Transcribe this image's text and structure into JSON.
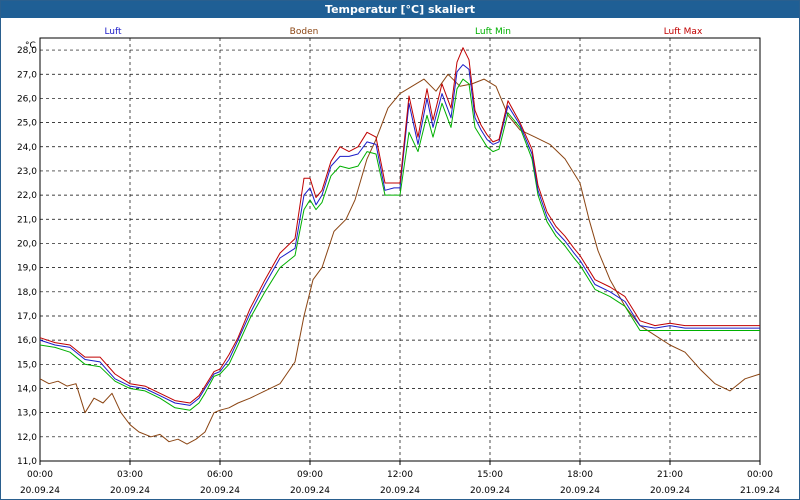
{
  "window": {
    "title": "Temperatur [°C] skaliert"
  },
  "chart_data": {
    "type": "line",
    "unit_label": "°C",
    "ylim": [
      11.0,
      28.5
    ],
    "y_ticks": [
      "11,0",
      "12,0",
      "13,0",
      "14,0",
      "15,0",
      "16,0",
      "17,0",
      "18,0",
      "19,0",
      "20,0",
      "21,0",
      "22,0",
      "23,0",
      "24,0",
      "25,0",
      "26,0",
      "27,0",
      "28,0"
    ],
    "xlim": [
      0,
      24
    ],
    "x_ticks": [
      {
        "time": "00:00",
        "date": "20.09.24"
      },
      {
        "time": "03:00",
        "date": "20.09.24"
      },
      {
        "time": "06:00",
        "date": "20.09.24"
      },
      {
        "time": "09:00",
        "date": "20.09.24"
      },
      {
        "time": "12:00",
        "date": "20.09.24"
      },
      {
        "time": "15:00",
        "date": "20.09.24"
      },
      {
        "time": "18:00",
        "date": "20.09.24"
      },
      {
        "time": "21:00",
        "date": "20.09.24"
      },
      {
        "time": "00:00",
        "date": "21.09.24"
      }
    ],
    "grid": true,
    "legend_position": "top",
    "series": [
      {
        "name": "Luft",
        "color": "#1c1cc8",
        "x": [
          0,
          0.5,
          1,
          1.5,
          2,
          2.5,
          3,
          3.5,
          4,
          4.5,
          5,
          5.3,
          5.5,
          5.8,
          6,
          6.3,
          6.6,
          7,
          7.5,
          8,
          8.5,
          8.8,
          9,
          9.2,
          9.4,
          9.7,
          10,
          10.3,
          10.6,
          10.9,
          11.2,
          11.5,
          11.8,
          12,
          12.3,
          12.6,
          12.9,
          13.1,
          13.4,
          13.7,
          13.9,
          14.1,
          14.3,
          14.5,
          14.7,
          14.9,
          15.1,
          15.3,
          15.6,
          16,
          16.4,
          16.6,
          16.9,
          17.2,
          17.5,
          17.8,
          18,
          18.5,
          19,
          19.5,
          20,
          20.5,
          21,
          21.5,
          22,
          22.5,
          23,
          23.5,
          24
        ],
        "values": [
          16.0,
          15.8,
          15.7,
          15.2,
          15.1,
          14.4,
          14.1,
          14.0,
          13.7,
          13.4,
          13.3,
          13.6,
          14.0,
          14.6,
          14.7,
          15.2,
          16.0,
          17.1,
          18.3,
          19.4,
          19.8,
          22.0,
          22.3,
          21.6,
          22.0,
          23.2,
          23.6,
          23.6,
          23.7,
          24.2,
          24.1,
          22.2,
          22.3,
          22.3,
          25.8,
          24.1,
          26.0,
          24.8,
          26.2,
          25.2,
          27.1,
          27.4,
          27.2,
          25.2,
          24.7,
          24.3,
          24.1,
          24.2,
          25.7,
          24.9,
          23.7,
          22.2,
          21.1,
          20.5,
          20.1,
          19.6,
          19.3,
          18.3,
          18.0,
          17.6,
          16.6,
          16.5,
          16.6,
          16.5,
          16.5,
          16.5,
          16.5,
          16.5,
          16.5
        ]
      },
      {
        "name": "Boden",
        "color": "#8b4513",
        "x": [
          0,
          0.3,
          0.6,
          0.9,
          1.2,
          1.5,
          1.8,
          2.1,
          2.4,
          2.7,
          3,
          3.3,
          3.7,
          4,
          4.3,
          4.6,
          4.9,
          5.2,
          5.5,
          5.8,
          6,
          6.3,
          6.6,
          7,
          7.5,
          8,
          8.5,
          8.8,
          9.1,
          9.4,
          9.8,
          10.2,
          10.5,
          10.9,
          11.2,
          11.6,
          12,
          12.4,
          12.8,
          13.2,
          13.6,
          14,
          14.4,
          14.8,
          15.2,
          15.6,
          16,
          16.5,
          17,
          17.5,
          18,
          18.3,
          18.6,
          19,
          19.5,
          20,
          20.5,
          21,
          21.5,
          22,
          22.5,
          23,
          23.5,
          24
        ],
        "values": [
          14.4,
          14.2,
          14.3,
          14.1,
          14.2,
          13.0,
          13.6,
          13.4,
          13.8,
          13.0,
          12.5,
          12.2,
          12.0,
          12.1,
          11.8,
          11.9,
          11.7,
          11.9,
          12.2,
          13.0,
          13.1,
          13.2,
          13.4,
          13.6,
          13.9,
          14.2,
          15.1,
          17.0,
          18.5,
          19.0,
          20.5,
          21.0,
          21.8,
          23.5,
          24.3,
          25.6,
          26.2,
          26.5,
          26.8,
          26.3,
          27.0,
          26.5,
          26.6,
          26.8,
          26.5,
          25.3,
          24.7,
          24.4,
          24.1,
          23.5,
          22.5,
          21.0,
          19.7,
          18.5,
          17.4,
          16.6,
          16.2,
          15.8,
          15.5,
          14.8,
          14.2,
          13.9,
          14.4,
          14.6
        ]
      },
      {
        "name": "Luft Min",
        "color": "#00b000",
        "x": [
          0,
          0.5,
          1,
          1.5,
          2,
          2.5,
          3,
          3.5,
          4,
          4.5,
          5,
          5.3,
          5.5,
          5.8,
          6,
          6.3,
          6.6,
          7,
          7.5,
          8,
          8.5,
          8.8,
          9,
          9.2,
          9.4,
          9.7,
          10,
          10.3,
          10.6,
          10.9,
          11.2,
          11.5,
          11.8,
          12,
          12.3,
          12.6,
          12.9,
          13.1,
          13.4,
          13.7,
          13.9,
          14.1,
          14.3,
          14.5,
          14.7,
          14.9,
          15.1,
          15.3,
          15.6,
          16,
          16.4,
          16.6,
          16.9,
          17.2,
          17.5,
          17.8,
          18,
          18.5,
          19,
          19.5,
          20,
          20.5,
          21,
          21.5,
          22,
          22.5,
          23,
          23.5,
          24
        ],
        "values": [
          15.8,
          15.7,
          15.5,
          15.0,
          14.9,
          14.3,
          14.0,
          13.9,
          13.6,
          13.2,
          13.1,
          13.4,
          13.8,
          14.5,
          14.6,
          15.0,
          15.8,
          16.9,
          18.0,
          19.0,
          19.5,
          21.4,
          21.8,
          21.4,
          21.7,
          22.8,
          23.2,
          23.1,
          23.2,
          23.8,
          23.7,
          22.0,
          22.0,
          22.0,
          24.6,
          23.8,
          25.3,
          24.4,
          25.8,
          24.8,
          26.4,
          26.8,
          26.6,
          24.8,
          24.4,
          24.0,
          23.8,
          23.9,
          25.4,
          24.8,
          23.5,
          22.0,
          20.9,
          20.3,
          19.9,
          19.4,
          19.1,
          18.1,
          17.8,
          17.4,
          16.4,
          16.4,
          16.4,
          16.4,
          16.4,
          16.4,
          16.4,
          16.4,
          16.4
        ]
      },
      {
        "name": "Luft Max",
        "color": "#c00000",
        "x": [
          0,
          0.5,
          1,
          1.5,
          2,
          2.5,
          3,
          3.5,
          4,
          4.5,
          5,
          5.3,
          5.5,
          5.8,
          6,
          6.3,
          6.6,
          7,
          7.5,
          8,
          8.5,
          8.8,
          9,
          9.2,
          9.4,
          9.7,
          10,
          10.3,
          10.6,
          10.9,
          11.2,
          11.5,
          11.8,
          12,
          12.3,
          12.6,
          12.9,
          13.1,
          13.4,
          13.7,
          13.9,
          14.1,
          14.3,
          14.5,
          14.7,
          14.9,
          15.1,
          15.3,
          15.6,
          16,
          16.4,
          16.6,
          16.9,
          17.2,
          17.5,
          17.8,
          18,
          18.5,
          19,
          19.5,
          20,
          20.5,
          21,
          21.5,
          22,
          22.5,
          23,
          23.5,
          24
        ],
        "values": [
          16.1,
          15.9,
          15.8,
          15.3,
          15.3,
          14.6,
          14.2,
          14.1,
          13.8,
          13.5,
          13.4,
          13.7,
          14.1,
          14.7,
          14.8,
          15.4,
          16.1,
          17.3,
          18.5,
          19.6,
          20.2,
          22.7,
          22.7,
          21.9,
          22.2,
          23.4,
          24.0,
          23.8,
          24.0,
          24.6,
          24.4,
          22.5,
          22.5,
          22.5,
          26.1,
          24.4,
          26.4,
          25.1,
          26.6,
          25.6,
          27.5,
          28.1,
          27.6,
          25.5,
          24.9,
          24.5,
          24.2,
          24.3,
          25.9,
          25.0,
          23.9,
          22.4,
          21.3,
          20.7,
          20.3,
          19.8,
          19.5,
          18.5,
          18.2,
          17.8,
          16.8,
          16.6,
          16.7,
          16.6,
          16.6,
          16.6,
          16.6,
          16.6,
          16.6
        ]
      }
    ]
  }
}
